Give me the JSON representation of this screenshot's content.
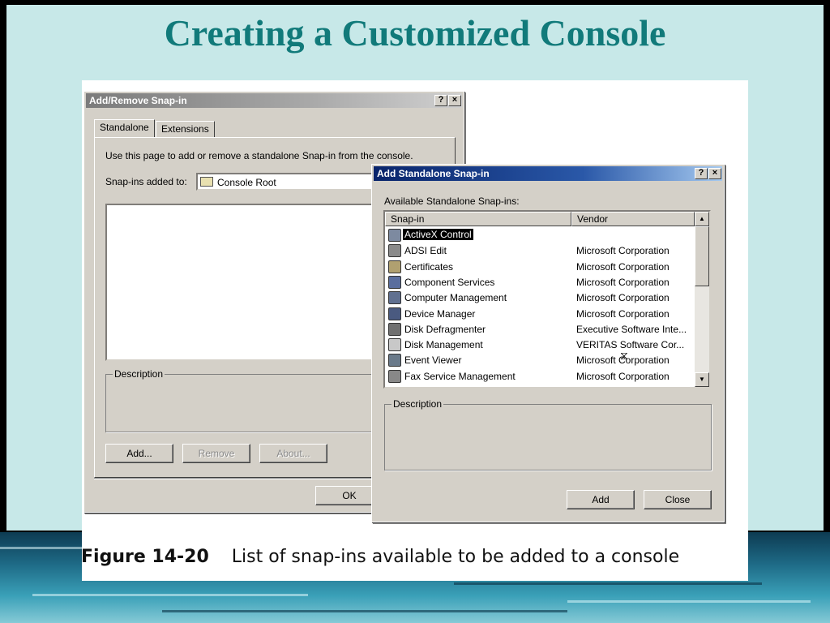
{
  "slide": {
    "title": "Creating a Customized Console",
    "caption_figure": "Figure 14-20",
    "caption_text": "List of snap-ins available to be added to a console"
  },
  "addremove": {
    "title": "Add/Remove Snap-in",
    "help_btn": "?",
    "close_btn": "×",
    "tab_standalone": "Standalone",
    "tab_extensions": "Extensions",
    "instruction": "Use this page to add or remove a standalone Snap-in from the console.",
    "snapins_added_label": "Snap-ins added to:",
    "snapins_added_value": "Console Root",
    "description_label": "Description",
    "add_btn": "Add...",
    "remove_btn": "Remove",
    "about_btn": "About...",
    "ok_btn": "OK"
  },
  "addstandalone": {
    "title": "Add Standalone Snap-in",
    "help_btn": "?",
    "close_btn": "×",
    "available_label": "Available Standalone Snap-ins:",
    "col_snapin": "Snap-in",
    "col_vendor": "Vendor",
    "rows": [
      {
        "name": "ActiveX Control",
        "vendor": "",
        "icon": "activex-icon",
        "selected": true
      },
      {
        "name": "ADSI Edit",
        "vendor": "Microsoft Corporation",
        "icon": "adsi-icon",
        "selected": false
      },
      {
        "name": "Certificates",
        "vendor": "Microsoft Corporation",
        "icon": "certificate-icon",
        "selected": false
      },
      {
        "name": "Component Services",
        "vendor": "Microsoft Corporation",
        "icon": "component-services-icon",
        "selected": false
      },
      {
        "name": "Computer Management",
        "vendor": "Microsoft Corporation",
        "icon": "computer-icon",
        "selected": false
      },
      {
        "name": "Device Manager",
        "vendor": "Microsoft Corporation",
        "icon": "device-manager-icon",
        "selected": false
      },
      {
        "name": "Disk Defragmenter",
        "vendor": "Executive Software Inte...",
        "icon": "defrag-icon",
        "selected": false
      },
      {
        "name": "Disk Management",
        "vendor": "VERITAS Software Cor...",
        "icon": "disk-icon",
        "selected": false
      },
      {
        "name": "Event Viewer",
        "vendor": "Microsoft Corporation",
        "icon": "event-viewer-icon",
        "selected": false
      },
      {
        "name": "Fax Service Management",
        "vendor": "Microsoft Corporation",
        "icon": "fax-icon",
        "selected": false
      }
    ],
    "description_label": "Description",
    "add_btn": "Add",
    "close_btn_label": "Close"
  }
}
